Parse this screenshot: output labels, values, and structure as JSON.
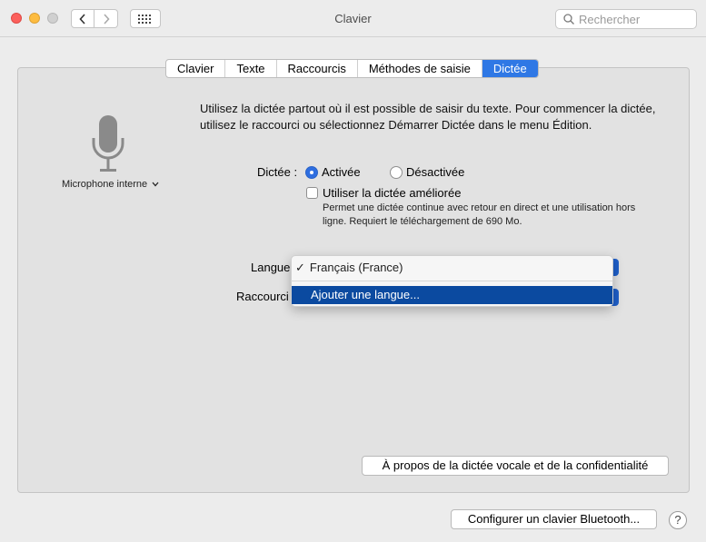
{
  "window": {
    "title": "Clavier",
    "search_placeholder": "Rechercher"
  },
  "tabs": [
    {
      "label": "Clavier"
    },
    {
      "label": "Texte"
    },
    {
      "label": "Raccourcis"
    },
    {
      "label": "Méthodes de saisie"
    },
    {
      "label": "Dictée",
      "active": true
    }
  ],
  "mic": {
    "source_label": "Microphone interne"
  },
  "description": "Utilisez la dictée partout où il est possible de saisir du texte. Pour commencer la dictée, utilisez le raccourci ou sélectionnez Démarrer Dictée dans le menu Édition.",
  "dictation": {
    "label": "Dictée :",
    "on_label": "Activée",
    "off_label": "Désactivée",
    "enhanced_label": "Utiliser la dictée améliorée",
    "enhanced_note": "Permet une dictée continue avec retour en direct et une utilisation hors ligne. Requiert le téléchargement de 690 Mo."
  },
  "language": {
    "label": "Langue",
    "menu": {
      "selected": "Français (France)",
      "add": "Ajouter une langue..."
    }
  },
  "shortcut": {
    "label": "Raccourci"
  },
  "buttons": {
    "about": "À propos de la dictée vocale et de la confidentialité",
    "bluetooth": "Configurer un clavier Bluetooth...",
    "help": "?"
  },
  "colors": {
    "accent": "#2f78e5",
    "menu_highlight": "#0b4aa0"
  }
}
